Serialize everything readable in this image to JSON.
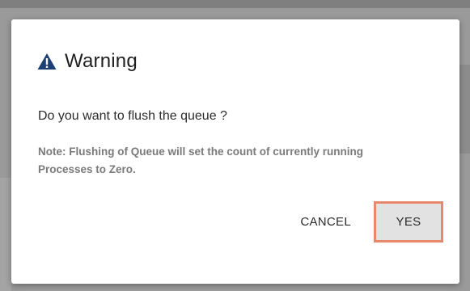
{
  "dialog": {
    "title": "Warning",
    "question": "Do you want to flush the queue ?",
    "note": "Note: Flushing of Queue will set the count of currently running Processes to Zero.",
    "icon": "warning-triangle-icon",
    "buttons": {
      "cancel_label": "CANCEL",
      "yes_label": "YES"
    },
    "colors": {
      "icon": "#1d3f73",
      "focus_border": "#e8886b",
      "primary_button_bg": "#e2e2e2"
    }
  }
}
